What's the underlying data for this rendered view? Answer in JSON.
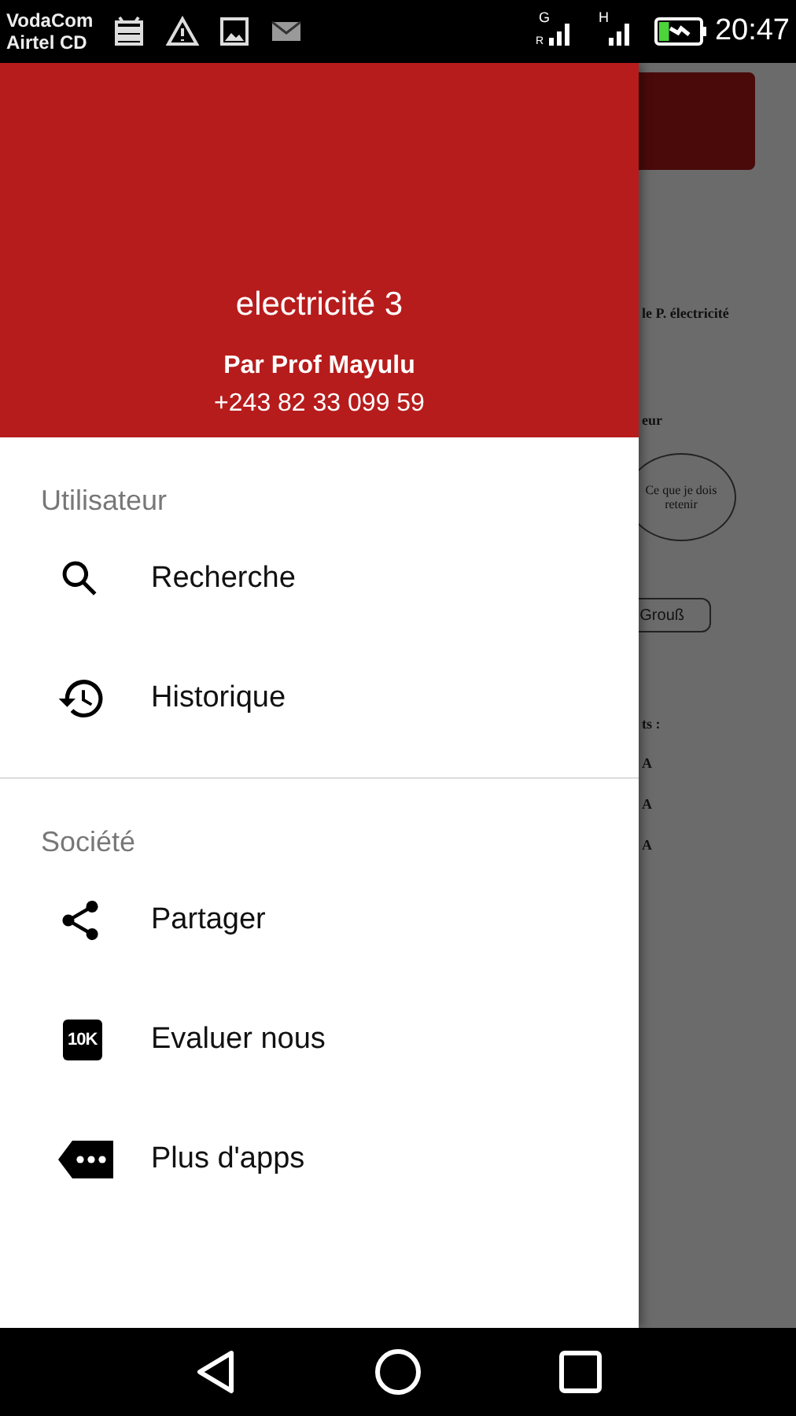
{
  "status_bar": {
    "carrier_lines": [
      "VodaCom",
      "Airtel CD"
    ],
    "signal_labels": [
      "G",
      "R",
      "H"
    ],
    "battery": {
      "level": 0.25,
      "charging": true
    },
    "time": "20:47"
  },
  "drawer": {
    "header": {
      "title": "electricité 3",
      "author": "Par Prof Mayulu",
      "phone": "+243 82 33 099 59"
    },
    "sections": [
      {
        "title": "Utilisateur",
        "items": [
          {
            "kind": "search",
            "label": "Recherche"
          },
          {
            "kind": "history",
            "label": "Historique"
          }
        ]
      },
      {
        "title": "Société",
        "items": [
          {
            "kind": "share",
            "label": "Partager"
          },
          {
            "kind": "badge",
            "badge": "10K",
            "label": "Evaluer nous"
          },
          {
            "kind": "more",
            "label": "Plus d'apps"
          }
        ]
      }
    ]
  },
  "background_page": {
    "texts": [
      "le P. électricité",
      "eur",
      "Ce que je dois retenir",
      "Grouß",
      "ts :",
      "A",
      "A",
      "A"
    ]
  }
}
